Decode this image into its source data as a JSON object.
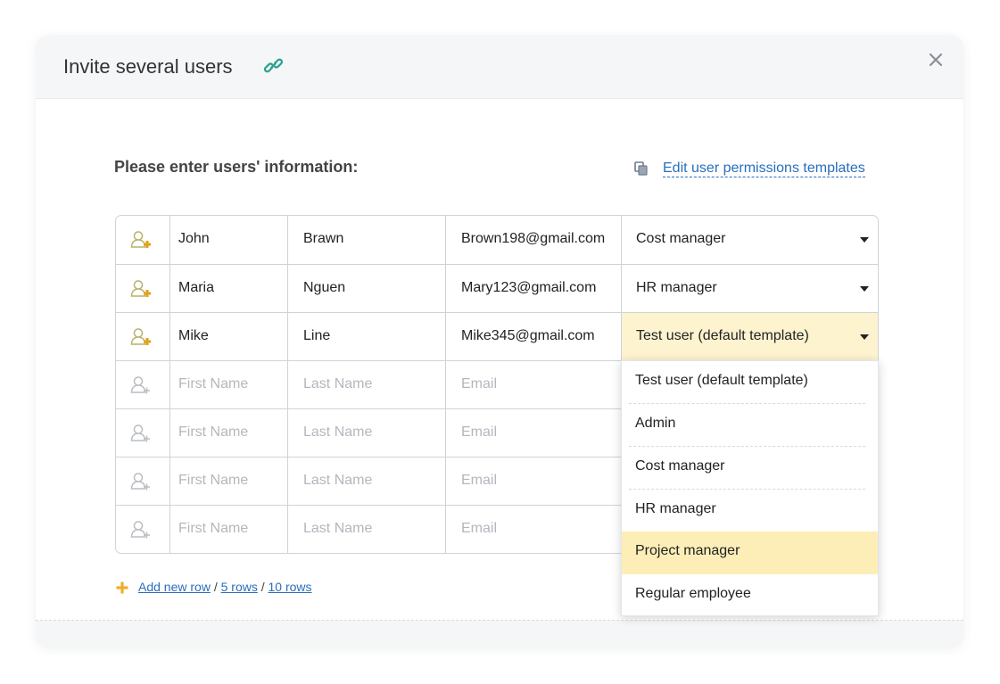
{
  "dialog": {
    "title": "Invite several users",
    "close_label": "×"
  },
  "form": {
    "heading": "Please enter users' information:",
    "templates_link": "Edit user permissions templates"
  },
  "rows": [
    {
      "first": "John",
      "last": "Brawn",
      "email": "Brown198@gmail.com",
      "role": "Cost manager"
    },
    {
      "first": "Maria",
      "last": "Nguen",
      "email": "Mary123@gmail.com",
      "role": "HR manager"
    },
    {
      "first": "Mike",
      "last": "Line",
      "email": "Mike345@gmail.com",
      "role": "Test user (default template)"
    }
  ],
  "placeholders": {
    "first": "First Name",
    "last": "Last Name",
    "email": "Email"
  },
  "role_dropdown": {
    "options": [
      "Test user (default template)",
      "Admin",
      "Cost manager",
      "HR manager",
      "Project manager",
      "Regular employee"
    ],
    "highlighted": "Project manager"
  },
  "add_rows": {
    "add_new": "Add new row",
    "five": "5 rows",
    "ten": "10 rows",
    "separator": " / "
  },
  "colors": {
    "accent": "#2a6ebb",
    "highlight": "#fdeeb8",
    "active_row": "#fdf3cf",
    "user_icon": "#e3a21a"
  }
}
